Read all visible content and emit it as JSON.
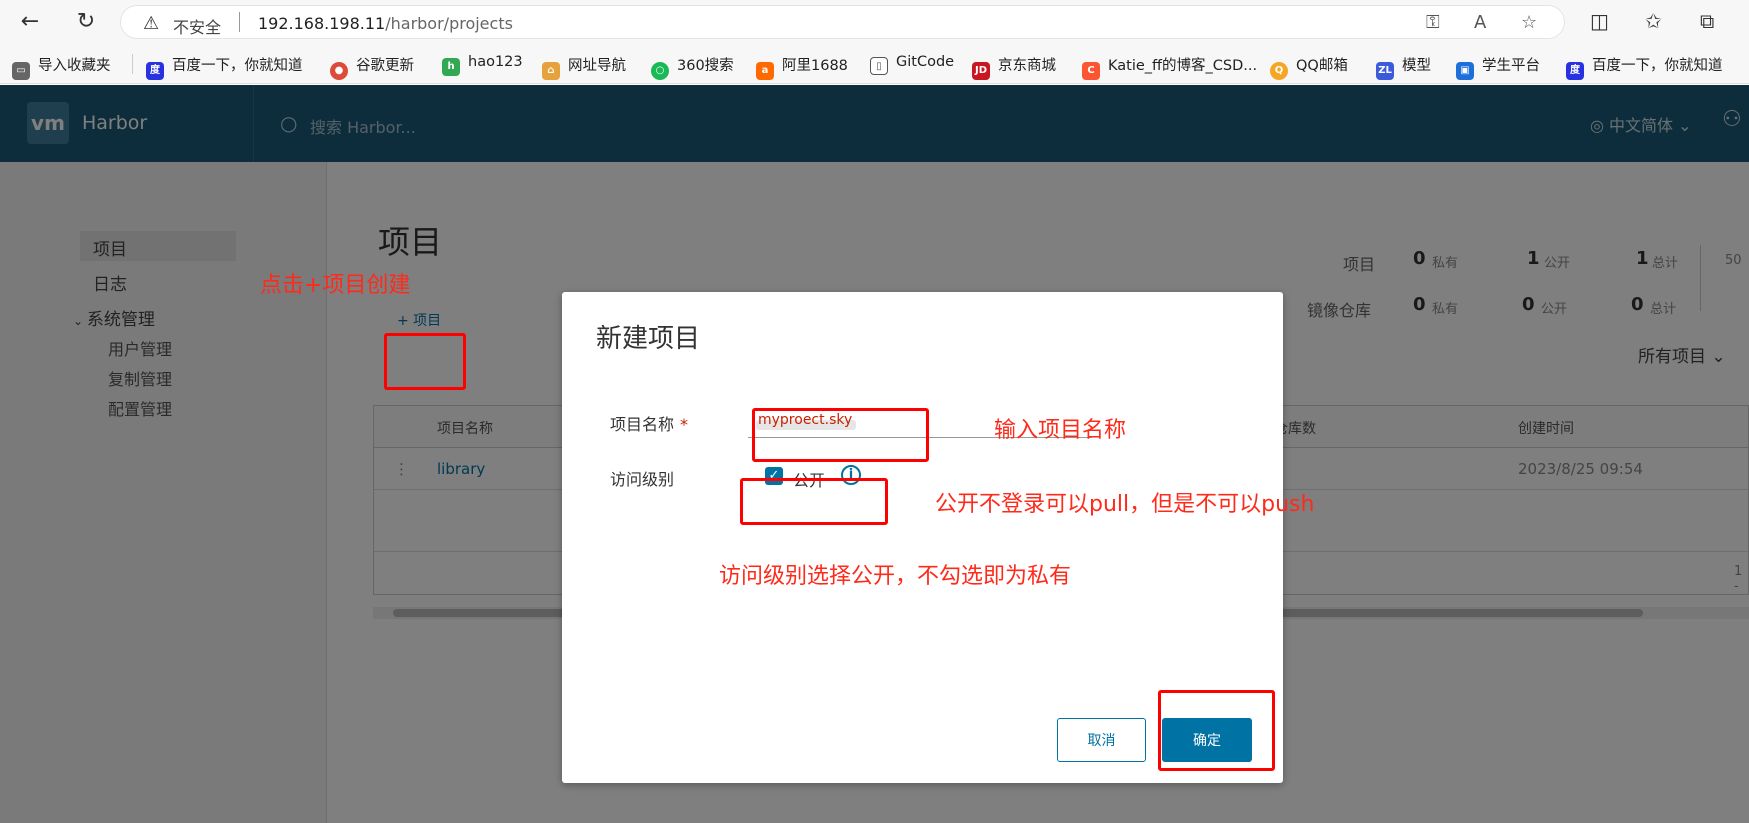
{
  "browser": {
    "insecure_label": "不安全",
    "url_host": "192.168.198.11",
    "url_path": "/harbor/projects",
    "bookmarks": [
      {
        "label": "导入收藏夹",
        "color": "#555"
      },
      {
        "label": "百度一下，你就知道",
        "color": "#2932e1"
      },
      {
        "label": "谷歌更新",
        "color": "#dd4b39"
      },
      {
        "label": "hao123",
        "color": "#32a852"
      },
      {
        "label": "网址导航",
        "color": "#e6a23c"
      },
      {
        "label": "360搜索",
        "color": "#19b955"
      },
      {
        "label": "阿里1688",
        "color": "#ff6a00"
      },
      {
        "label": "GitCode",
        "color": "#666"
      },
      {
        "label": "京东商城",
        "color": "#c81623"
      },
      {
        "label": "Katie_ff的博客_CSD...",
        "color": "#fc5531"
      },
      {
        "label": "QQ邮箱",
        "color": "#f5a623"
      },
      {
        "label": "模型",
        "color": "#3b5bdb"
      },
      {
        "label": "学生平台",
        "color": "#1e6fd9"
      },
      {
        "label": "百度一下，你就知道",
        "color": "#2932e1"
      }
    ]
  },
  "app": {
    "logo": "vm",
    "brand": "Harbor",
    "search_placeholder": "搜索 Harbor...",
    "language": "中文简体 ⌄"
  },
  "sidebar": {
    "items": [
      "项目",
      "日志",
      "系统管理"
    ],
    "sub_items": [
      "用户管理",
      "复制管理",
      "配置管理"
    ]
  },
  "main": {
    "title": "项目",
    "add_label": "+ 项目",
    "filter_label": "所有项目 ⌄",
    "stats": {
      "row1_label": "项目",
      "row2_label": "镜像仓库",
      "private_label": "私有",
      "public_label": "公开",
      "total_label": "总计",
      "row1": {
        "private": "0",
        "public": "1",
        "total": "1"
      },
      "row2": {
        "private": "0",
        "public": "0",
        "total": "0"
      },
      "extra": "50"
    },
    "table": {
      "headers": [
        "项目名称",
        "仓库数",
        "创建时间"
      ],
      "rows": [
        {
          "name": "library",
          "created": "2023/8/25 09:54"
        }
      ],
      "footer": "1 -"
    }
  },
  "modal": {
    "title": "新建项目",
    "name_label": "项目名称",
    "required_mark": "*",
    "name_value": "myproect.sky",
    "access_label": "访问级别",
    "public_label": "公开",
    "info_glyph": "i",
    "cancel_label": "取消",
    "ok_label": "确定"
  },
  "annotations": {
    "add_hint": "点击+项目创建",
    "name_hint": "输入项目名称",
    "public_hint": "公开不登录可以pull，但是不可以push",
    "access_hint": "访问级别选择公开，不勾选即为私有",
    "color": "#ff0000"
  }
}
